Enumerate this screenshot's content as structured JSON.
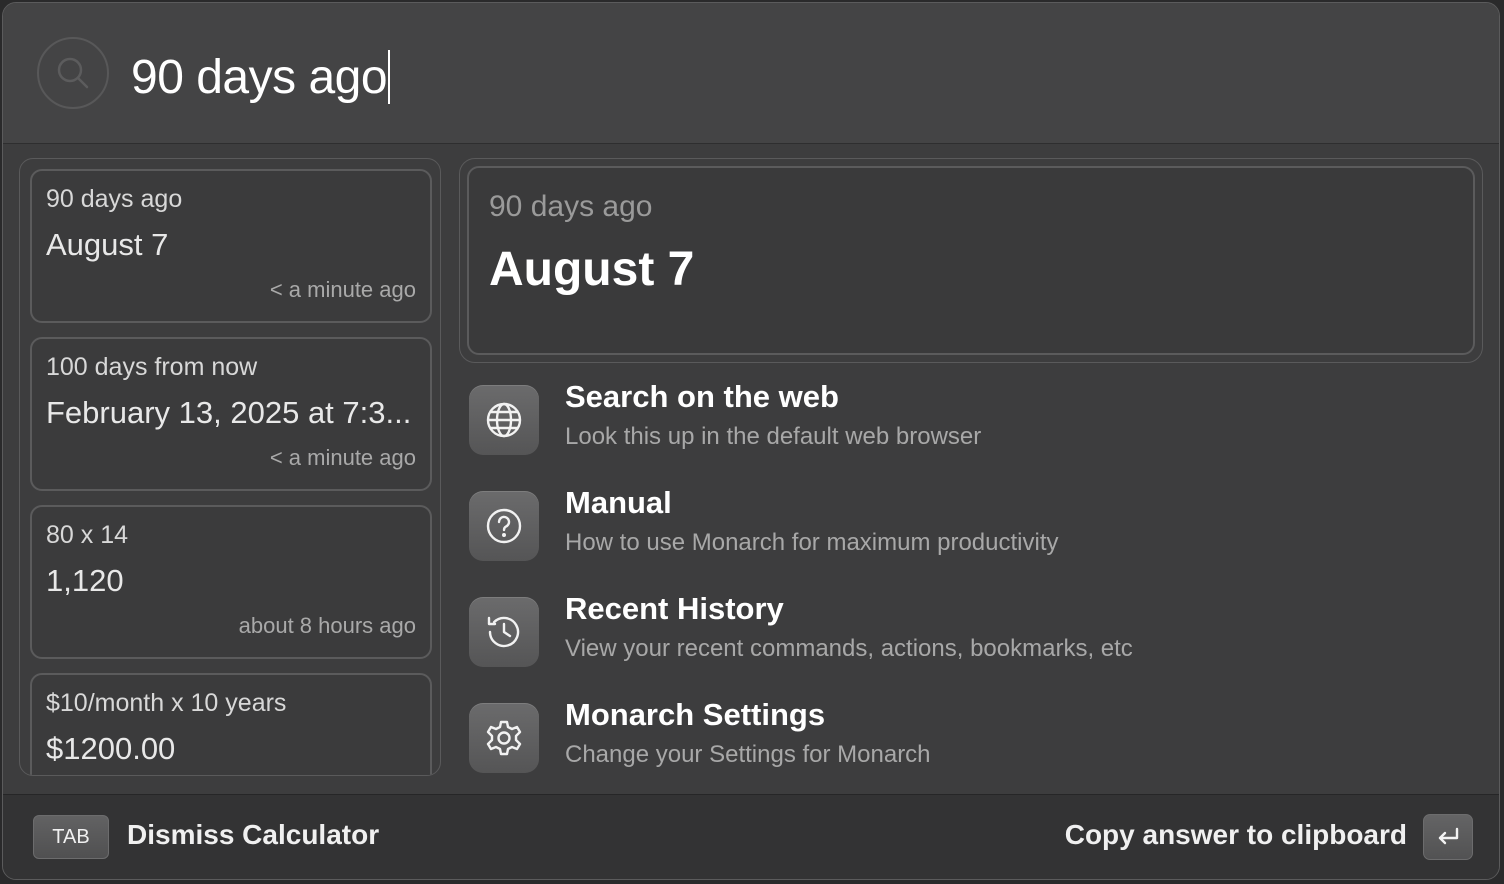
{
  "search": {
    "query": "90 days ago",
    "icon": "search-icon"
  },
  "history": [
    {
      "query": "90 days ago",
      "answer": "August 7",
      "time": "< a minute ago"
    },
    {
      "query": "100 days from now",
      "answer": "February 13, 2025 at 7:3...",
      "time": "< a minute ago"
    },
    {
      "query": "80 x 14",
      "answer": "1,120",
      "time": "about 8 hours ago"
    },
    {
      "query": "$10/month x 10 years",
      "answer": "$1200.00",
      "time": ""
    }
  ],
  "result": {
    "query": "90 days ago",
    "answer": "August 7"
  },
  "actions": [
    {
      "title": "Search on the web",
      "subtitle": "Look this up in the default web browser",
      "icon": "globe-icon"
    },
    {
      "title": "Manual",
      "subtitle": "How to use Monarch for maximum productivity",
      "icon": "question-circle-icon"
    },
    {
      "title": "Recent History",
      "subtitle": "View your recent commands, actions, bookmarks, etc",
      "icon": "history-icon"
    },
    {
      "title": "Monarch Settings",
      "subtitle": "Change your Settings for Monarch",
      "icon": "gear-icon"
    }
  ],
  "footer": {
    "tab_key": "TAB",
    "dismiss_label": "Dismiss Calculator",
    "copy_label": "Copy answer to clipboard",
    "enter_icon": "return-key-icon"
  }
}
